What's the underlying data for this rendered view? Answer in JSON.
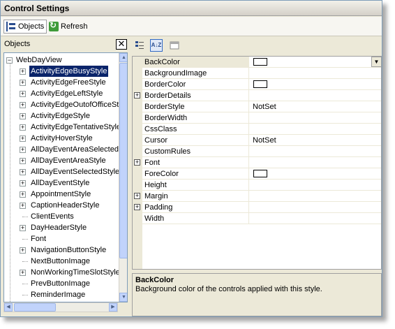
{
  "window": {
    "title": "Control Settings"
  },
  "toolbar": {
    "objects_label": "Objects",
    "objects_icon": "objects-tree-icon",
    "refresh_label": "Refresh",
    "refresh_icon": "refresh-icon"
  },
  "objects_panel": {
    "header": "Objects",
    "close_glyph": "✕",
    "root": "WebDayView",
    "items": [
      {
        "label": "ActivityEdgeBusyStyle",
        "expandable": true,
        "selected": true
      },
      {
        "label": "ActivityEdgeFreeStyle",
        "expandable": true
      },
      {
        "label": "ActivityEdgeLeftStyle",
        "expandable": true
      },
      {
        "label": "ActivityEdgeOutofOfficeSt",
        "expandable": true
      },
      {
        "label": "ActivityEdgeStyle",
        "expandable": true
      },
      {
        "label": "ActivityEdgeTentativeStyle",
        "expandable": true
      },
      {
        "label": "ActivityHoverStyle",
        "expandable": true
      },
      {
        "label": "AllDayEventAreaSelected",
        "expandable": true
      },
      {
        "label": "AllDayEventAreaStyle",
        "expandable": true
      },
      {
        "label": "AllDayEventSelectedStyle",
        "expandable": true
      },
      {
        "label": "AllDayEventStyle",
        "expandable": true
      },
      {
        "label": "AppointmentStyle",
        "expandable": true
      },
      {
        "label": "CaptionHeaderStyle",
        "expandable": true
      },
      {
        "label": "ClientEvents",
        "expandable": false
      },
      {
        "label": "DayHeaderStyle",
        "expandable": true
      },
      {
        "label": "Font",
        "expandable": false
      },
      {
        "label": "NavigationButtonStyle",
        "expandable": true
      },
      {
        "label": "NextButtonImage",
        "expandable": false
      },
      {
        "label": "NonWorkingTimeSlotStyle",
        "expandable": true
      },
      {
        "label": "PrevButtonImage",
        "expandable": false
      },
      {
        "label": "ReminderImage",
        "expandable": false
      }
    ]
  },
  "property_grid": {
    "toolbar": {
      "categorized_icon": "categorized-icon",
      "alphabetical_icon": "alphabetical-sort-icon",
      "alphabetical_glyph": "A↓Z",
      "pages_icon": "property-pages-icon"
    },
    "rows": [
      {
        "name": "BackColor",
        "value": "",
        "swatch": true,
        "expandable": false,
        "dropdown": true,
        "selected": true
      },
      {
        "name": "BackgroundImage",
        "value": "",
        "swatch": false,
        "expandable": false
      },
      {
        "name": "BorderColor",
        "value": "",
        "swatch": true,
        "expandable": false
      },
      {
        "name": "BorderDetails",
        "value": "",
        "swatch": false,
        "expandable": true
      },
      {
        "name": "BorderStyle",
        "value": "NotSet",
        "swatch": false,
        "expandable": false
      },
      {
        "name": "BorderWidth",
        "value": "",
        "swatch": false,
        "expandable": false
      },
      {
        "name": "CssClass",
        "value": "",
        "swatch": false,
        "expandable": false
      },
      {
        "name": "Cursor",
        "value": "NotSet",
        "swatch": false,
        "expandable": false
      },
      {
        "name": "CustomRules",
        "value": "",
        "swatch": false,
        "expandable": false
      },
      {
        "name": "Font",
        "value": "",
        "swatch": false,
        "expandable": true
      },
      {
        "name": "ForeColor",
        "value": "",
        "swatch": true,
        "expandable": false
      },
      {
        "name": "Height",
        "value": "",
        "swatch": false,
        "expandable": false
      },
      {
        "name": "Margin",
        "value": "",
        "swatch": false,
        "expandable": true
      },
      {
        "name": "Padding",
        "value": "",
        "swatch": false,
        "expandable": true
      },
      {
        "name": "Width",
        "value": "",
        "swatch": false,
        "expandable": false
      }
    ],
    "help": {
      "title": "BackColor",
      "description": "Background color of the controls applied with this style."
    }
  }
}
